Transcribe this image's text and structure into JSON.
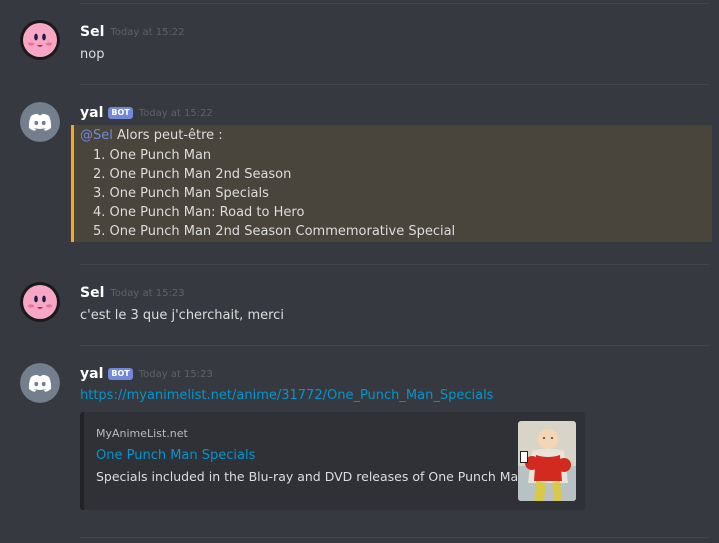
{
  "messages": [
    {
      "author": "Sel",
      "timestamp": "Today at 15:22",
      "text": "nop"
    },
    {
      "author": "yal",
      "bot_tag": "BOT",
      "timestamp": "Today at 15:22",
      "mention": "@Sel",
      "intro": " Alors peut-être :",
      "list": [
        "1. One Punch Man",
        "2. One Punch Man 2nd Season",
        "3. One Punch Man Specials",
        "4. One Punch Man: Road to Hero",
        "5. One Punch Man 2nd Season Commemorative Special"
      ]
    },
    {
      "author": "Sel",
      "timestamp": "Today at 15:23",
      "text": "c'est le 3 que j'cherchait, merci"
    },
    {
      "author": "yal",
      "bot_tag": "BOT",
      "timestamp": "Today at 15:23",
      "link": "https://myanimelist.net/anime/31772/One_Punch_Man_Specials",
      "embed": {
        "provider": "MyAnimeList.net",
        "title": "One Punch Man Specials",
        "description": "Specials included in the Blu-ray and DVD releases of One Punch Man."
      }
    }
  ],
  "colors": {
    "accent": "#7289da",
    "link": "#0096cf",
    "mention_bar": "#faa61a",
    "background": "#36393f"
  },
  "icons": {
    "sel_avatar": "kirby-avatar-icon",
    "yal_avatar": "discord-logo-avatar-icon",
    "thumbnail": "anime-cover-thumbnail"
  }
}
